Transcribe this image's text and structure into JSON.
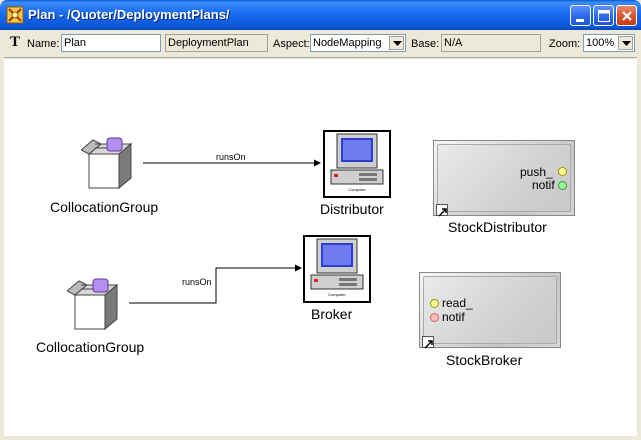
{
  "window": {
    "title": "Plan - /Quoter/DeploymentPlans/"
  },
  "toolbar": {
    "name_label": "Name:",
    "name_value": "Plan",
    "kind_value": "DeploymentPlan",
    "aspect_label": "Aspect:",
    "aspect_value": "NodeMapping",
    "base_label": "Base:",
    "base_value": "N/A",
    "zoom_label": "Zoom:",
    "zoom_value": "100%"
  },
  "diagram": {
    "groups": [
      {
        "label": "CollocationGroup"
      },
      {
        "label": "CollocationGroup"
      }
    ],
    "nodes": [
      {
        "label": "Distributor"
      },
      {
        "label": "Broker"
      }
    ],
    "links": [
      {
        "label": "runsOn"
      },
      {
        "label": "runsOn"
      }
    ],
    "components": [
      {
        "label": "StockDistributor",
        "ports": [
          "push_",
          "notif"
        ],
        "port_colors": [
          "#ffff99",
          "#99ff99"
        ]
      },
      {
        "label": "StockBroker",
        "ports": [
          "read_",
          "notif"
        ],
        "port_colors": [
          "#ffff99",
          "#ffbbbb"
        ]
      }
    ],
    "computer_caption": "Computer"
  }
}
